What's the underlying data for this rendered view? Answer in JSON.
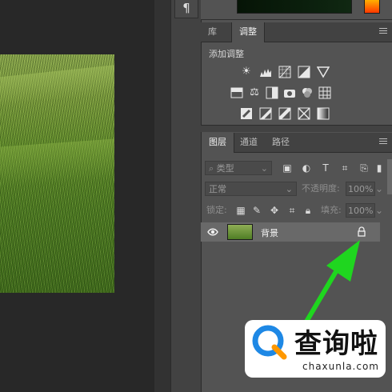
{
  "dock": {
    "paragraph_symbol": "¶"
  },
  "adjust_panel": {
    "tabs": [
      {
        "label": "库"
      },
      {
        "label": "调整"
      }
    ],
    "active_tab": "调整",
    "title": "添加调整",
    "rows": [
      [
        "brightness-contrast-icon",
        "levels-icon",
        "curves-icon",
        "exposure-icon",
        "gradient-triangle-icon"
      ],
      [
        "vibrance-icon",
        "color-balance-icon",
        "black-white-icon",
        "photo-filter-icon",
        "channel-mixer-icon",
        "color-lookup-icon"
      ],
      [
        "invert-icon",
        "posterize-icon",
        "threshold-icon",
        "selective-color-icon",
        "gradient-map-icon"
      ]
    ]
  },
  "layers_panel": {
    "tabs": [
      {
        "label": "图层"
      },
      {
        "label": "通道"
      },
      {
        "label": "路径"
      }
    ],
    "active_tab": "图层",
    "filter_placeholder": "类型",
    "blend_mode": "正常",
    "opacity_label": "不透明度:",
    "opacity_value": "100%",
    "lock_label": "锁定:",
    "fill_label": "填充:",
    "fill_value": "100%",
    "layers": [
      {
        "name": "背景",
        "visible": true,
        "locked": true
      }
    ]
  },
  "watermark": {
    "title": "查询啦",
    "subtitle": "chaxunla.com"
  },
  "colors": {
    "arrow": "#1fd61f",
    "panel": "#535353",
    "selected_layer": "#696969"
  }
}
